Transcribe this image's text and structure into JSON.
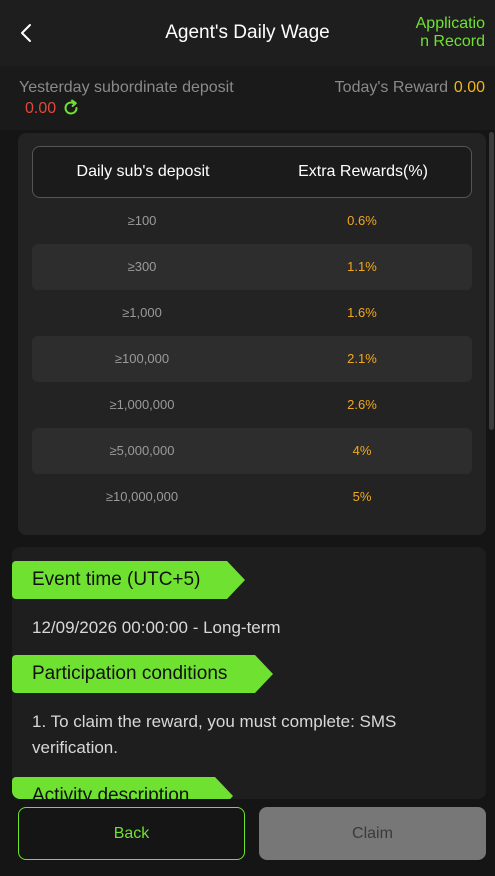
{
  "header": {
    "title": "Agent's Daily Wage",
    "record_link": "Application Record"
  },
  "stats": {
    "yesterday_label": "Yesterday subordinate deposit",
    "yesterday_value": "0.00",
    "today_label": "Today's Reward",
    "today_value": "0.00"
  },
  "table": {
    "headers": [
      "Daily sub's deposit",
      "Extra Rewards(%)"
    ],
    "rows": [
      {
        "deposit": "≥100",
        "reward": "0.6%"
      },
      {
        "deposit": "≥300",
        "reward": "1.1%"
      },
      {
        "deposit": "≥1,000",
        "reward": "1.6%"
      },
      {
        "deposit": "≥100,000",
        "reward": "2.1%"
      },
      {
        "deposit": "≥1,000,000",
        "reward": "2.6%"
      },
      {
        "deposit": "≥5,000,000",
        "reward": "4%"
      },
      {
        "deposit": "≥10,000,000",
        "reward": "5%"
      }
    ]
  },
  "info": {
    "event_time_title": "Event time (UTC+5)",
    "event_time_value": "12/09/2026 00:00:00 - Long-term",
    "conditions_title": "Participation conditions",
    "conditions_value": "1. To claim the reward, you must complete: SMS verification.",
    "description_title": "Activity description"
  },
  "footer": {
    "back_label": "Back",
    "claim_label": "Claim"
  },
  "colors": {
    "accent": "#6fe131",
    "reward": "#f2a81c",
    "negative": "#e0493c",
    "background": "#151515"
  },
  "icons": {
    "back": "chevron-left-icon",
    "refresh": "refresh-icon"
  }
}
